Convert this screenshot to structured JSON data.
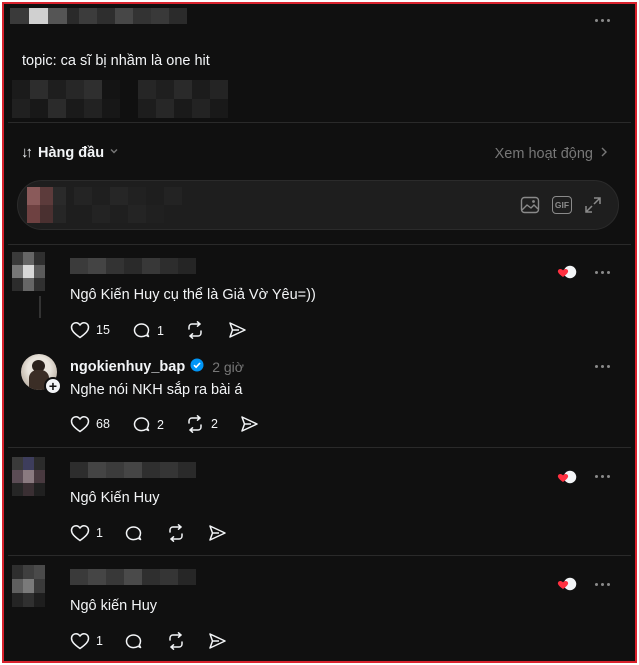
{
  "colors": {
    "background": "#101010",
    "text": "#f3f5f7",
    "muted": "#777777",
    "verified": "#0095f6",
    "heart": "#ff3040",
    "frame": "#d9232e"
  },
  "header": {
    "more_icon": "more-horizontal-icon"
  },
  "topic_text": "topic: ca sĩ bị nhầm là one hit",
  "sort": {
    "label": "Hàng đầu",
    "icon": "sort-arrows-icon",
    "chevron": "chevron-down-icon"
  },
  "activity": {
    "label": "Xem hoạt động",
    "chevron": "chevron-right-icon"
  },
  "composer": {
    "image_icon": "image-icon",
    "gif_label": "GIF",
    "expand_icon": "expand-icon"
  },
  "comments": [
    {
      "text": "Ngô Kiến Huy cụ thể là Giả Vờ Yêu=))",
      "likes": "15",
      "replies": "1",
      "reposts": "",
      "author_liked": true
    },
    {
      "username": "ngokienhuy_bap",
      "verified": true,
      "time": "2 giờ",
      "text": "Nghe nói NKH sắp ra bài á",
      "likes": "68",
      "replies": "2",
      "reposts": "2"
    },
    {
      "text": "Ngô Kiến Huy",
      "likes": "1",
      "replies": "",
      "reposts": "",
      "author_liked": true
    },
    {
      "text": "Ngô kiến Huy",
      "likes": "1",
      "replies": "",
      "reposts": "",
      "author_liked": true
    }
  ]
}
